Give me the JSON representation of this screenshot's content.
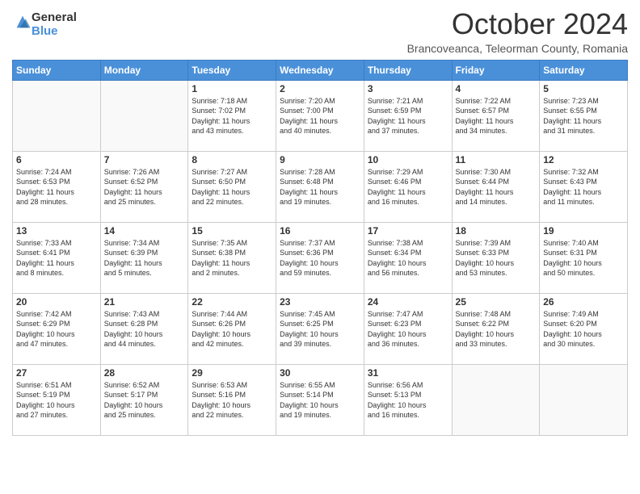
{
  "logo": {
    "general": "General",
    "blue": "Blue"
  },
  "header": {
    "month": "October 2024",
    "subtitle": "Brancoveanca, Teleorman County, Romania"
  },
  "weekdays": [
    "Sunday",
    "Monday",
    "Tuesday",
    "Wednesday",
    "Thursday",
    "Friday",
    "Saturday"
  ],
  "weeks": [
    [
      {
        "day": "",
        "info": ""
      },
      {
        "day": "",
        "info": ""
      },
      {
        "day": "1",
        "info": "Sunrise: 7:18 AM\nSunset: 7:02 PM\nDaylight: 11 hours\nand 43 minutes."
      },
      {
        "day": "2",
        "info": "Sunrise: 7:20 AM\nSunset: 7:00 PM\nDaylight: 11 hours\nand 40 minutes."
      },
      {
        "day": "3",
        "info": "Sunrise: 7:21 AM\nSunset: 6:59 PM\nDaylight: 11 hours\nand 37 minutes."
      },
      {
        "day": "4",
        "info": "Sunrise: 7:22 AM\nSunset: 6:57 PM\nDaylight: 11 hours\nand 34 minutes."
      },
      {
        "day": "5",
        "info": "Sunrise: 7:23 AM\nSunset: 6:55 PM\nDaylight: 11 hours\nand 31 minutes."
      }
    ],
    [
      {
        "day": "6",
        "info": "Sunrise: 7:24 AM\nSunset: 6:53 PM\nDaylight: 11 hours\nand 28 minutes."
      },
      {
        "day": "7",
        "info": "Sunrise: 7:26 AM\nSunset: 6:52 PM\nDaylight: 11 hours\nand 25 minutes."
      },
      {
        "day": "8",
        "info": "Sunrise: 7:27 AM\nSunset: 6:50 PM\nDaylight: 11 hours\nand 22 minutes."
      },
      {
        "day": "9",
        "info": "Sunrise: 7:28 AM\nSunset: 6:48 PM\nDaylight: 11 hours\nand 19 minutes."
      },
      {
        "day": "10",
        "info": "Sunrise: 7:29 AM\nSunset: 6:46 PM\nDaylight: 11 hours\nand 16 minutes."
      },
      {
        "day": "11",
        "info": "Sunrise: 7:30 AM\nSunset: 6:44 PM\nDaylight: 11 hours\nand 14 minutes."
      },
      {
        "day": "12",
        "info": "Sunrise: 7:32 AM\nSunset: 6:43 PM\nDaylight: 11 hours\nand 11 minutes."
      }
    ],
    [
      {
        "day": "13",
        "info": "Sunrise: 7:33 AM\nSunset: 6:41 PM\nDaylight: 11 hours\nand 8 minutes."
      },
      {
        "day": "14",
        "info": "Sunrise: 7:34 AM\nSunset: 6:39 PM\nDaylight: 11 hours\nand 5 minutes."
      },
      {
        "day": "15",
        "info": "Sunrise: 7:35 AM\nSunset: 6:38 PM\nDaylight: 11 hours\nand 2 minutes."
      },
      {
        "day": "16",
        "info": "Sunrise: 7:37 AM\nSunset: 6:36 PM\nDaylight: 10 hours\nand 59 minutes."
      },
      {
        "day": "17",
        "info": "Sunrise: 7:38 AM\nSunset: 6:34 PM\nDaylight: 10 hours\nand 56 minutes."
      },
      {
        "day": "18",
        "info": "Sunrise: 7:39 AM\nSunset: 6:33 PM\nDaylight: 10 hours\nand 53 minutes."
      },
      {
        "day": "19",
        "info": "Sunrise: 7:40 AM\nSunset: 6:31 PM\nDaylight: 10 hours\nand 50 minutes."
      }
    ],
    [
      {
        "day": "20",
        "info": "Sunrise: 7:42 AM\nSunset: 6:29 PM\nDaylight: 10 hours\nand 47 minutes."
      },
      {
        "day": "21",
        "info": "Sunrise: 7:43 AM\nSunset: 6:28 PM\nDaylight: 10 hours\nand 44 minutes."
      },
      {
        "day": "22",
        "info": "Sunrise: 7:44 AM\nSunset: 6:26 PM\nDaylight: 10 hours\nand 42 minutes."
      },
      {
        "day": "23",
        "info": "Sunrise: 7:45 AM\nSunset: 6:25 PM\nDaylight: 10 hours\nand 39 minutes."
      },
      {
        "day": "24",
        "info": "Sunrise: 7:47 AM\nSunset: 6:23 PM\nDaylight: 10 hours\nand 36 minutes."
      },
      {
        "day": "25",
        "info": "Sunrise: 7:48 AM\nSunset: 6:22 PM\nDaylight: 10 hours\nand 33 minutes."
      },
      {
        "day": "26",
        "info": "Sunrise: 7:49 AM\nSunset: 6:20 PM\nDaylight: 10 hours\nand 30 minutes."
      }
    ],
    [
      {
        "day": "27",
        "info": "Sunrise: 6:51 AM\nSunset: 5:19 PM\nDaylight: 10 hours\nand 27 minutes."
      },
      {
        "day": "28",
        "info": "Sunrise: 6:52 AM\nSunset: 5:17 PM\nDaylight: 10 hours\nand 25 minutes."
      },
      {
        "day": "29",
        "info": "Sunrise: 6:53 AM\nSunset: 5:16 PM\nDaylight: 10 hours\nand 22 minutes."
      },
      {
        "day": "30",
        "info": "Sunrise: 6:55 AM\nSunset: 5:14 PM\nDaylight: 10 hours\nand 19 minutes."
      },
      {
        "day": "31",
        "info": "Sunrise: 6:56 AM\nSunset: 5:13 PM\nDaylight: 10 hours\nand 16 minutes."
      },
      {
        "day": "",
        "info": ""
      },
      {
        "day": "",
        "info": ""
      }
    ]
  ]
}
